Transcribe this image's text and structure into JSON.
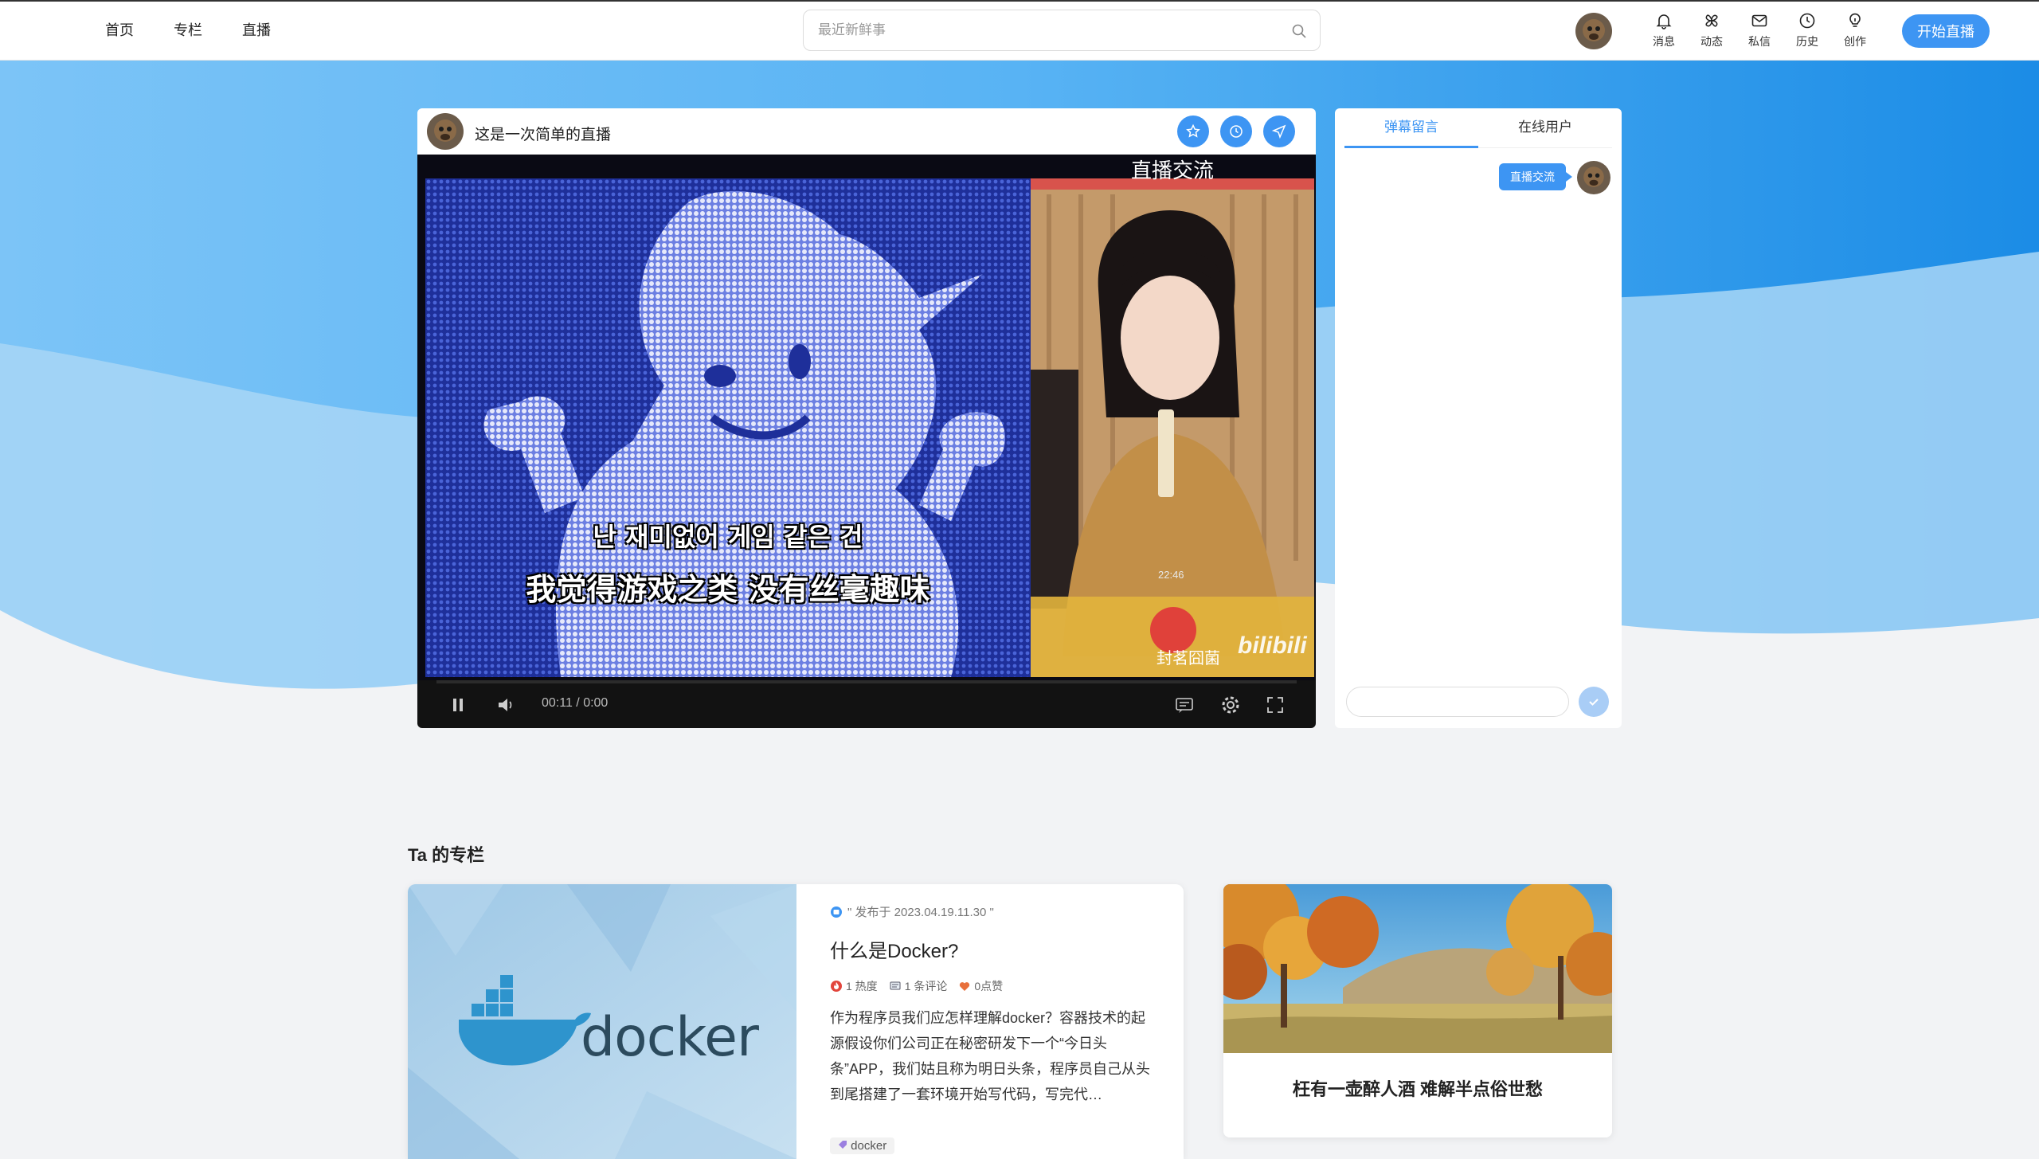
{
  "nav": {
    "links": [
      "首页",
      "专栏",
      "直播"
    ],
    "search_placeholder": "最近新鲜事",
    "icons": [
      {
        "label": "消息",
        "icon": "bell-icon"
      },
      {
        "label": "动态",
        "icon": "pinwheel-icon"
      },
      {
        "label": "私信",
        "icon": "mail-icon"
      },
      {
        "label": "历史",
        "icon": "clock-icon"
      },
      {
        "label": "创作",
        "icon": "bulb-icon"
      }
    ],
    "live_button": "开始直播"
  },
  "player": {
    "title": "这是一次简单的直播",
    "actions": [
      "star-icon",
      "clock-icon",
      "send-icon"
    ],
    "video": {
      "caption_top": "直播交流",
      "subtitle_ko": "난 재미없어 게임 같은 건",
      "subtitle_zh": "我觉得游戏之类 没有丝毫趣味",
      "call_time": "22:46",
      "watermark_left": "封茗囧菌",
      "watermark_right": "bilibili"
    },
    "time": "00:11 / 0:00",
    "progress": 0.0
  },
  "chat": {
    "tabs": [
      "弹幕留言",
      "在线用户"
    ],
    "active_tab": 0,
    "messages": [
      {
        "text": "直播交流"
      }
    ],
    "input_value": ""
  },
  "columns": {
    "section_title": "Ta 的专栏",
    "main_article": {
      "date": "\" 发布于 2023.04.19.11.30 \"",
      "title": "什么是Docker?",
      "heat": "1 热度",
      "comments": "1 条评论",
      "likes": "0点赞",
      "summary": "作为程序员我们应怎样理解docker？容器技术的起源假设你们公司正在秘密研发下一个“今日头条”APP，我们姑且称为明日头条，程序员自己从头到尾搭建了一套环境开始写代码，写完代…",
      "image_text": "docker",
      "tag": "docker"
    },
    "side_article": {
      "title": "枉有一壶醉人酒 难解半点俗世愁"
    }
  },
  "colors": {
    "accent": "#3d95f3",
    "hero_blue": "#56b4f4"
  }
}
